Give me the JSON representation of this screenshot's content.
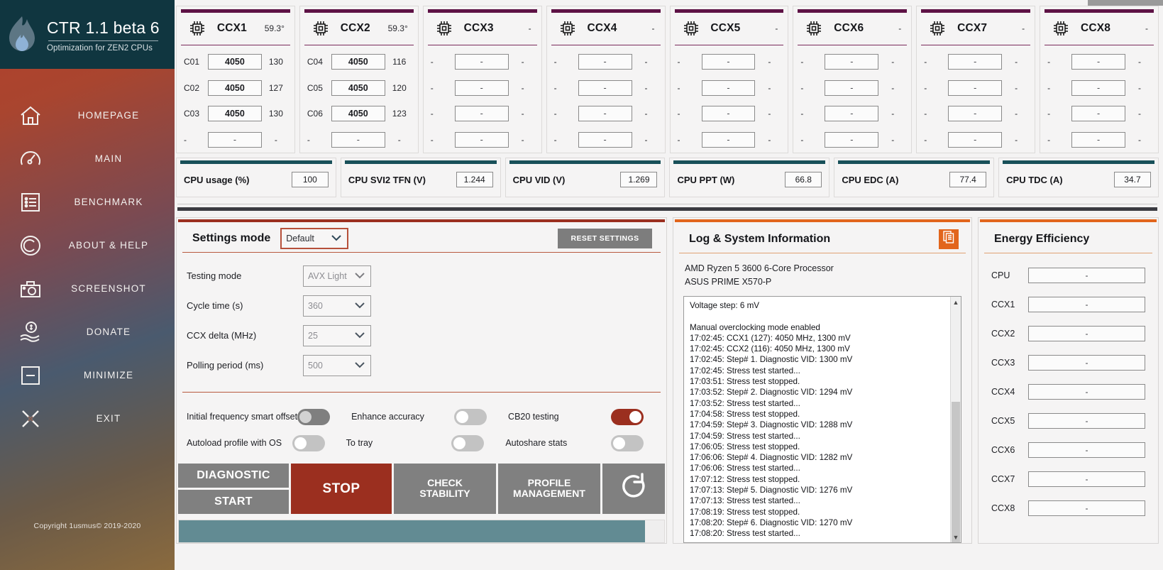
{
  "sidebar": {
    "brand_title": "CTR 1.1 beta 6",
    "brand_subtitle": "Optimization for ZEN2 CPUs",
    "logo_icon": "flame-icon",
    "copyright": "Copyright 1usmus© 2019-2020",
    "items": [
      {
        "label": "HOMEPAGE",
        "icon": "home-icon"
      },
      {
        "label": "MAIN",
        "icon": "gauge-icon"
      },
      {
        "label": "BENCHMARK",
        "icon": "list-icon"
      },
      {
        "label": "ABOUT & HELP",
        "icon": "copyright-icon"
      },
      {
        "label": "SCREENSHOT",
        "icon": "camera-icon"
      },
      {
        "label": "DONATE",
        "icon": "donate-hand-coin-icon"
      },
      {
        "label": "MINIMIZE",
        "icon": "minimize-icon"
      },
      {
        "label": "EXIT",
        "icon": "exit-cross-icon"
      }
    ]
  },
  "colors": {
    "accent_ccx": "#5e1245",
    "accent_stat": "#185059",
    "accent_settings": "#9b2f1f",
    "accent_log": "#e2651c",
    "stop_red": "#9b2f1f",
    "progress": "#628b93",
    "header_bg": "#103640"
  },
  "ccx_panels": [
    {
      "name": "CCX1",
      "temp": "59.3°",
      "icon": "cpu-chip-icon",
      "rows": [
        {
          "core": "C01",
          "freq": "4050",
          "val": "130"
        },
        {
          "core": "C02",
          "freq": "4050",
          "val": "127"
        },
        {
          "core": "C03",
          "freq": "4050",
          "val": "130"
        },
        {
          "core": "-",
          "freq": "-",
          "val": "-"
        }
      ]
    },
    {
      "name": "CCX2",
      "temp": "59.3°",
      "icon": "cpu-chip-icon",
      "rows": [
        {
          "core": "C04",
          "freq": "4050",
          "val": "116"
        },
        {
          "core": "C05",
          "freq": "4050",
          "val": "120"
        },
        {
          "core": "C06",
          "freq": "4050",
          "val": "123"
        },
        {
          "core": "-",
          "freq": "-",
          "val": "-"
        }
      ]
    },
    {
      "name": "CCX3",
      "temp": "-",
      "icon": "cpu-chip-icon",
      "rows": [
        {
          "core": "-",
          "freq": "-",
          "val": "-"
        },
        {
          "core": "-",
          "freq": "-",
          "val": "-"
        },
        {
          "core": "-",
          "freq": "-",
          "val": "-"
        },
        {
          "core": "-",
          "freq": "-",
          "val": "-"
        }
      ]
    },
    {
      "name": "CCX4",
      "temp": "-",
      "icon": "cpu-chip-icon",
      "rows": [
        {
          "core": "-",
          "freq": "-",
          "val": "-"
        },
        {
          "core": "-",
          "freq": "-",
          "val": "-"
        },
        {
          "core": "-",
          "freq": "-",
          "val": "-"
        },
        {
          "core": "-",
          "freq": "-",
          "val": "-"
        }
      ]
    },
    {
      "name": "CCX5",
      "temp": "-",
      "icon": "cpu-chip-icon",
      "rows": [
        {
          "core": "-",
          "freq": "-",
          "val": "-"
        },
        {
          "core": "-",
          "freq": "-",
          "val": "-"
        },
        {
          "core": "-",
          "freq": "-",
          "val": "-"
        },
        {
          "core": "-",
          "freq": "-",
          "val": "-"
        }
      ]
    },
    {
      "name": "CCX6",
      "temp": "-",
      "icon": "cpu-chip-icon",
      "rows": [
        {
          "core": "-",
          "freq": "-",
          "val": "-"
        },
        {
          "core": "-",
          "freq": "-",
          "val": "-"
        },
        {
          "core": "-",
          "freq": "-",
          "val": "-"
        },
        {
          "core": "-",
          "freq": "-",
          "val": "-"
        }
      ]
    },
    {
      "name": "CCX7",
      "temp": "-",
      "icon": "cpu-chip-icon",
      "rows": [
        {
          "core": "-",
          "freq": "-",
          "val": "-"
        },
        {
          "core": "-",
          "freq": "-",
          "val": "-"
        },
        {
          "core": "-",
          "freq": "-",
          "val": "-"
        },
        {
          "core": "-",
          "freq": "-",
          "val": "-"
        }
      ]
    },
    {
      "name": "CCX8",
      "temp": "-",
      "icon": "cpu-chip-icon",
      "rows": [
        {
          "core": "-",
          "freq": "-",
          "val": "-"
        },
        {
          "core": "-",
          "freq": "-",
          "val": "-"
        },
        {
          "core": "-",
          "freq": "-",
          "val": "-"
        },
        {
          "core": "-",
          "freq": "-",
          "val": "-"
        }
      ]
    }
  ],
  "stats": [
    {
      "label": "CPU usage (%)",
      "value": "100"
    },
    {
      "label": "CPU SVI2 TFN (V)",
      "value": "1.244"
    },
    {
      "label": "CPU VID (V)",
      "value": "1.269"
    },
    {
      "label": "CPU PPT (W)",
      "value": "66.8"
    },
    {
      "label": "CPU EDC (A)",
      "value": "77.4"
    },
    {
      "label": "CPU TDC (A)",
      "value": "34.7"
    }
  ],
  "settings": {
    "title": "Settings mode",
    "mode_value": "Default",
    "reset_label": "RESET SETTINGS",
    "fields": [
      {
        "label": "Testing mode",
        "value": "AVX Light",
        "dim": true
      },
      {
        "label": "Cycle time (s)",
        "value": "360",
        "dim": true
      },
      {
        "label": "CCX delta (MHz)",
        "value": "25",
        "dim": true
      },
      {
        "label": "Polling period (ms)",
        "value": "500",
        "dim": true
      }
    ],
    "toggles": [
      {
        "label": "Initial frequency smart offset",
        "state": "off-dark"
      },
      {
        "label": "Enhance accuracy",
        "state": "off-light"
      },
      {
        "label": "CB20 testing",
        "state": "on"
      },
      {
        "label": "Autoload profile with OS",
        "state": "off-light"
      },
      {
        "label": "To tray",
        "state": "off-light"
      },
      {
        "label": "Autoshare stats",
        "state": "off-light"
      }
    ],
    "buttons": {
      "diagnostic": "DIAGNOSTIC",
      "start": "START",
      "stop": "STOP",
      "check_stability_line1": "CHECK",
      "check_stability_line2": "STABILITY",
      "profile_line1": "PROFILE",
      "profile_line2": "MANAGEMENT",
      "refresh_icon": "refresh-icon"
    }
  },
  "log": {
    "title": "Log & System Information",
    "copy_icon": "copy-icon",
    "cpu": "AMD Ryzen 5 3600 6-Core Processor",
    "motherboard": "ASUS PRIME X570-P",
    "lines": [
      "Voltage step: 6 mV",
      "",
      "Manual overclocking mode enabled",
      "17:02:45: CCX1 (127): 4050 MHz, 1300 mV",
      "17:02:45: CCX2 (116): 4050 MHz, 1300 mV",
      "17:02:45: Step# 1. Diagnostic VID: 1300 mV",
      "17:02:45: Stress test started...",
      "17:03:51: Stress test stopped.",
      "17:03:52: Step# 2. Diagnostic VID: 1294 mV",
      "17:03:52: Stress test started...",
      "17:04:58: Stress test stopped.",
      "17:04:59: Step# 3. Diagnostic VID: 1288 mV",
      "17:04:59: Stress test started...",
      "17:06:05: Stress test stopped.",
      "17:06:06: Step# 4. Diagnostic VID: 1282 mV",
      "17:06:06: Stress test started...",
      "17:07:12: Stress test stopped.",
      "17:07:13: Step# 5. Diagnostic VID: 1276 mV",
      "17:07:13: Stress test started...",
      "17:08:19: Stress test stopped.",
      "17:08:20: Step# 6. Diagnostic VID: 1270 mV",
      "17:08:20: Stress test started..."
    ]
  },
  "energy": {
    "title": "Energy Efficiency",
    "rows": [
      {
        "label": "CPU",
        "value": "-"
      },
      {
        "label": "CCX1",
        "value": "-"
      },
      {
        "label": "CCX2",
        "value": "-"
      },
      {
        "label": "CCX3",
        "value": "-"
      },
      {
        "label": "CCX4",
        "value": "-"
      },
      {
        "label": "CCX5",
        "value": "-"
      },
      {
        "label": "CCX6",
        "value": "-"
      },
      {
        "label": "CCX7",
        "value": "-"
      },
      {
        "label": "CCX8",
        "value": "-"
      }
    ]
  }
}
